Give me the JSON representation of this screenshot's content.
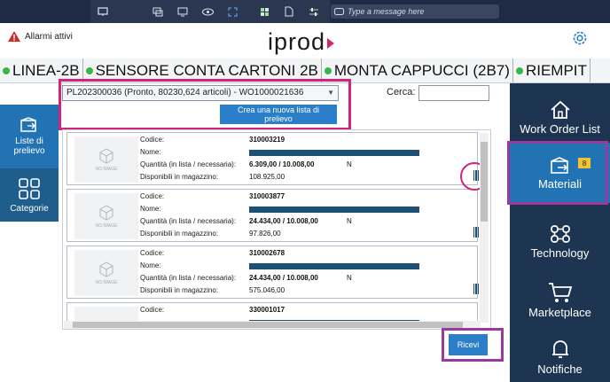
{
  "toolbar": {
    "icons": [
      "monitor-icon",
      "screens-icon",
      "display-icon",
      "eye-icon",
      "expand-icon",
      "grid-icon",
      "document-icon",
      "sliders-icon"
    ],
    "message_placeholder": "Type a message here"
  },
  "header": {
    "alarm_label": "Allarmi attivi",
    "logo": "iprod"
  },
  "stations": [
    {
      "label": "LINEA-2B"
    },
    {
      "label": "SENSORE CONTA CARTONI 2B"
    },
    {
      "label": "MONTA CAPPUCCI (2B7)"
    },
    {
      "label": "RIEMPIT"
    }
  ],
  "left_sidebar": {
    "liste_label": "Liste di prelievo",
    "categorie_label": "Categorie"
  },
  "main": {
    "select_value": "PL202300036 (Pronto, 80230,624 articoli) - WO1000021636",
    "create_button": "Crea una nuova lista di prelievo",
    "search_label": "Cerca:",
    "field_labels": {
      "codice": "Codice:",
      "nome": "Nome:",
      "quantita": "Quantità (in lista / necessaria):",
      "disponibili": "Disponibili in magazzino:"
    },
    "no_image": "NO IMAGE",
    "items": [
      {
        "codice": "310003219",
        "quantita": "6.309,00 / 10.008,00",
        "unit": "N",
        "disponibili": "108.925,00"
      },
      {
        "codice": "310003877",
        "quantita": "24.434,00 / 10.008,00",
        "unit": "N",
        "disponibili": "97.826,00"
      },
      {
        "codice": "310002678",
        "quantita": "24.434,00 / 10.008,00",
        "unit": "N",
        "disponibili": "575.046,00"
      },
      {
        "codice": "330001017"
      }
    ],
    "ricevi_button": "Ricevi"
  },
  "right_sidebar": {
    "work_order": "Work Order List",
    "materiali": "Materiali",
    "materiali_badge": "8",
    "technology": "Technology",
    "marketplace": "Marketplace",
    "notifiche": "Notifiche"
  },
  "colors": {
    "accent": "#2273b3",
    "highlight_pink": "#d3247d",
    "highlight_purple": "#9a3aa0",
    "sidebar": "#1d3550"
  }
}
